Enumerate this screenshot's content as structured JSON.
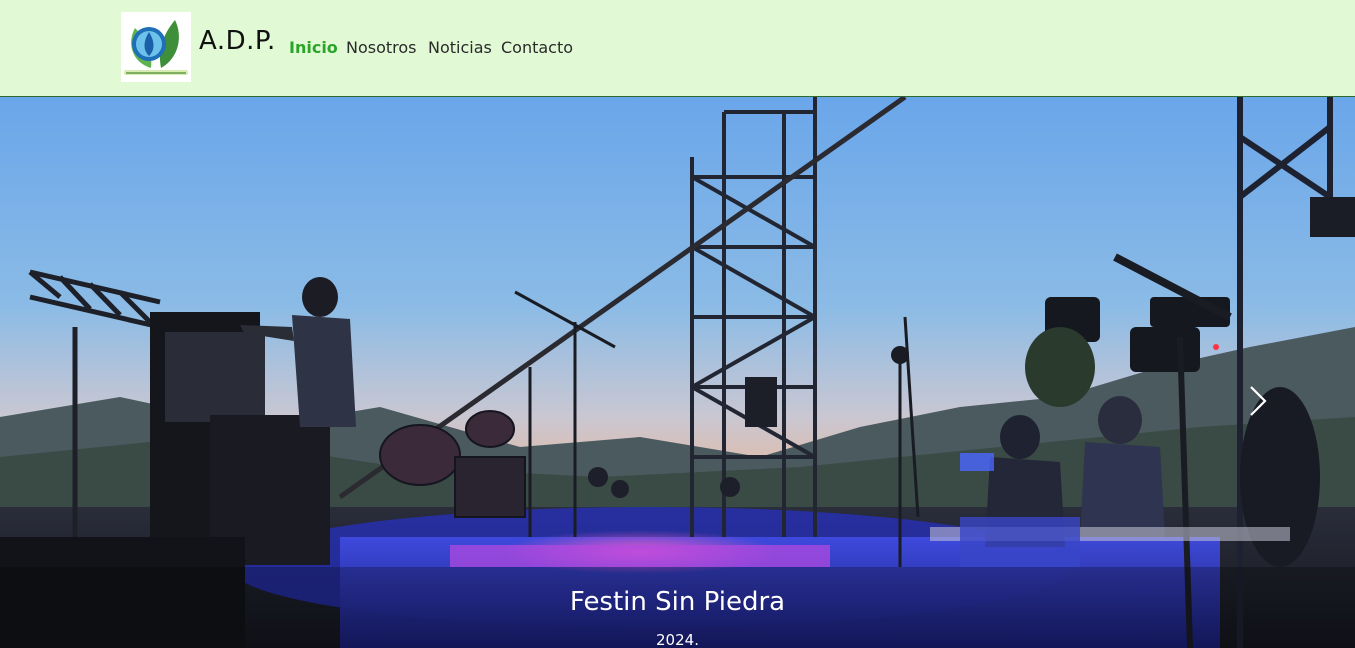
{
  "brand": {
    "logo_icon": "leaf-water-logo-icon",
    "name": "A.D.P."
  },
  "nav": {
    "items": [
      {
        "label": "Inicio",
        "active": true
      },
      {
        "label": "Nosotros",
        "active": false
      },
      {
        "label": "Noticias",
        "active": false
      },
      {
        "label": "Contacto",
        "active": false
      }
    ]
  },
  "carousel": {
    "slide_image": "concert-stage-at-dusk-photo",
    "next_icon": "chevron-right-icon",
    "caption_title": "Festin Sin Piedra",
    "caption_text": "2024."
  },
  "colors": {
    "navbar_bg": "#e1fad5",
    "nav_active": "#2aa52a",
    "nav_text": "#2a2a2a"
  }
}
